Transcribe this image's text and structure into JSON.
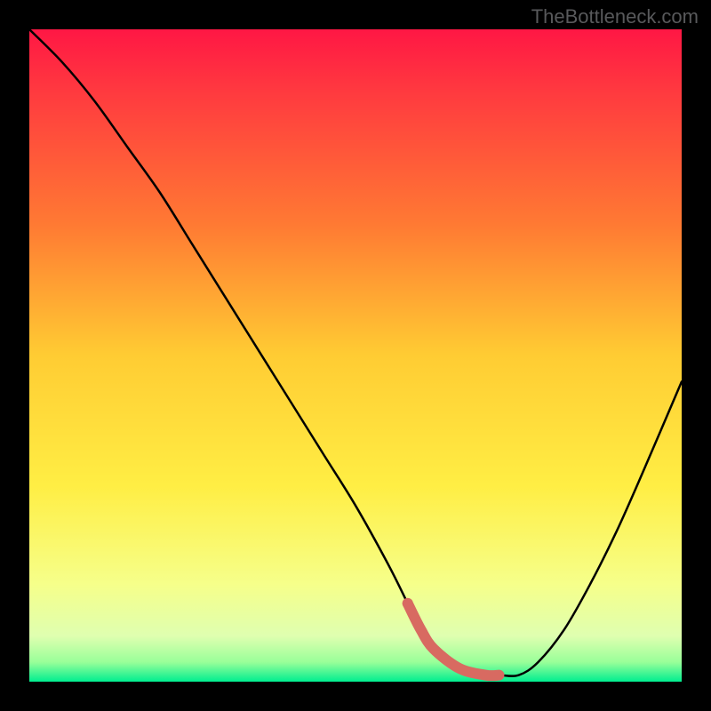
{
  "watermark": "TheBottleneck.com",
  "chart_data": {
    "type": "line",
    "title": "",
    "xlabel": "",
    "ylabel": "",
    "xlim": [
      0,
      100
    ],
    "ylim": [
      0,
      100
    ],
    "background_gradient": [
      {
        "stop": 0.0,
        "color": "#ff1744"
      },
      {
        "stop": 0.1,
        "color": "#ff3b3f"
      },
      {
        "stop": 0.3,
        "color": "#ff7a33"
      },
      {
        "stop": 0.5,
        "color": "#ffcc33"
      },
      {
        "stop": 0.7,
        "color": "#ffee44"
      },
      {
        "stop": 0.85,
        "color": "#f6ff8a"
      },
      {
        "stop": 0.93,
        "color": "#dfffb0"
      },
      {
        "stop": 0.97,
        "color": "#99ff99"
      },
      {
        "stop": 1.0,
        "color": "#00ee90"
      }
    ],
    "series": [
      {
        "name": "bottleneck-curve",
        "x": [
          0,
          5,
          10,
          15,
          20,
          25,
          30,
          35,
          40,
          45,
          50,
          55,
          58,
          60,
          62,
          66,
          70,
          72,
          75,
          78,
          82,
          86,
          90,
          94,
          100
        ],
        "y": [
          100,
          95,
          89,
          82,
          75,
          67,
          59,
          51,
          43,
          35,
          27,
          18,
          12,
          8,
          5,
          2,
          1,
          1,
          1,
          3,
          8,
          15,
          23,
          32,
          46
        ]
      }
    ],
    "highlight_segment": {
      "name": "optimal-range",
      "x": [
        58,
        60,
        62,
        66,
        70,
        72
      ],
      "y": [
        12,
        8,
        5,
        2,
        1,
        1
      ],
      "color": "#d86a61",
      "width": 12
    }
  }
}
